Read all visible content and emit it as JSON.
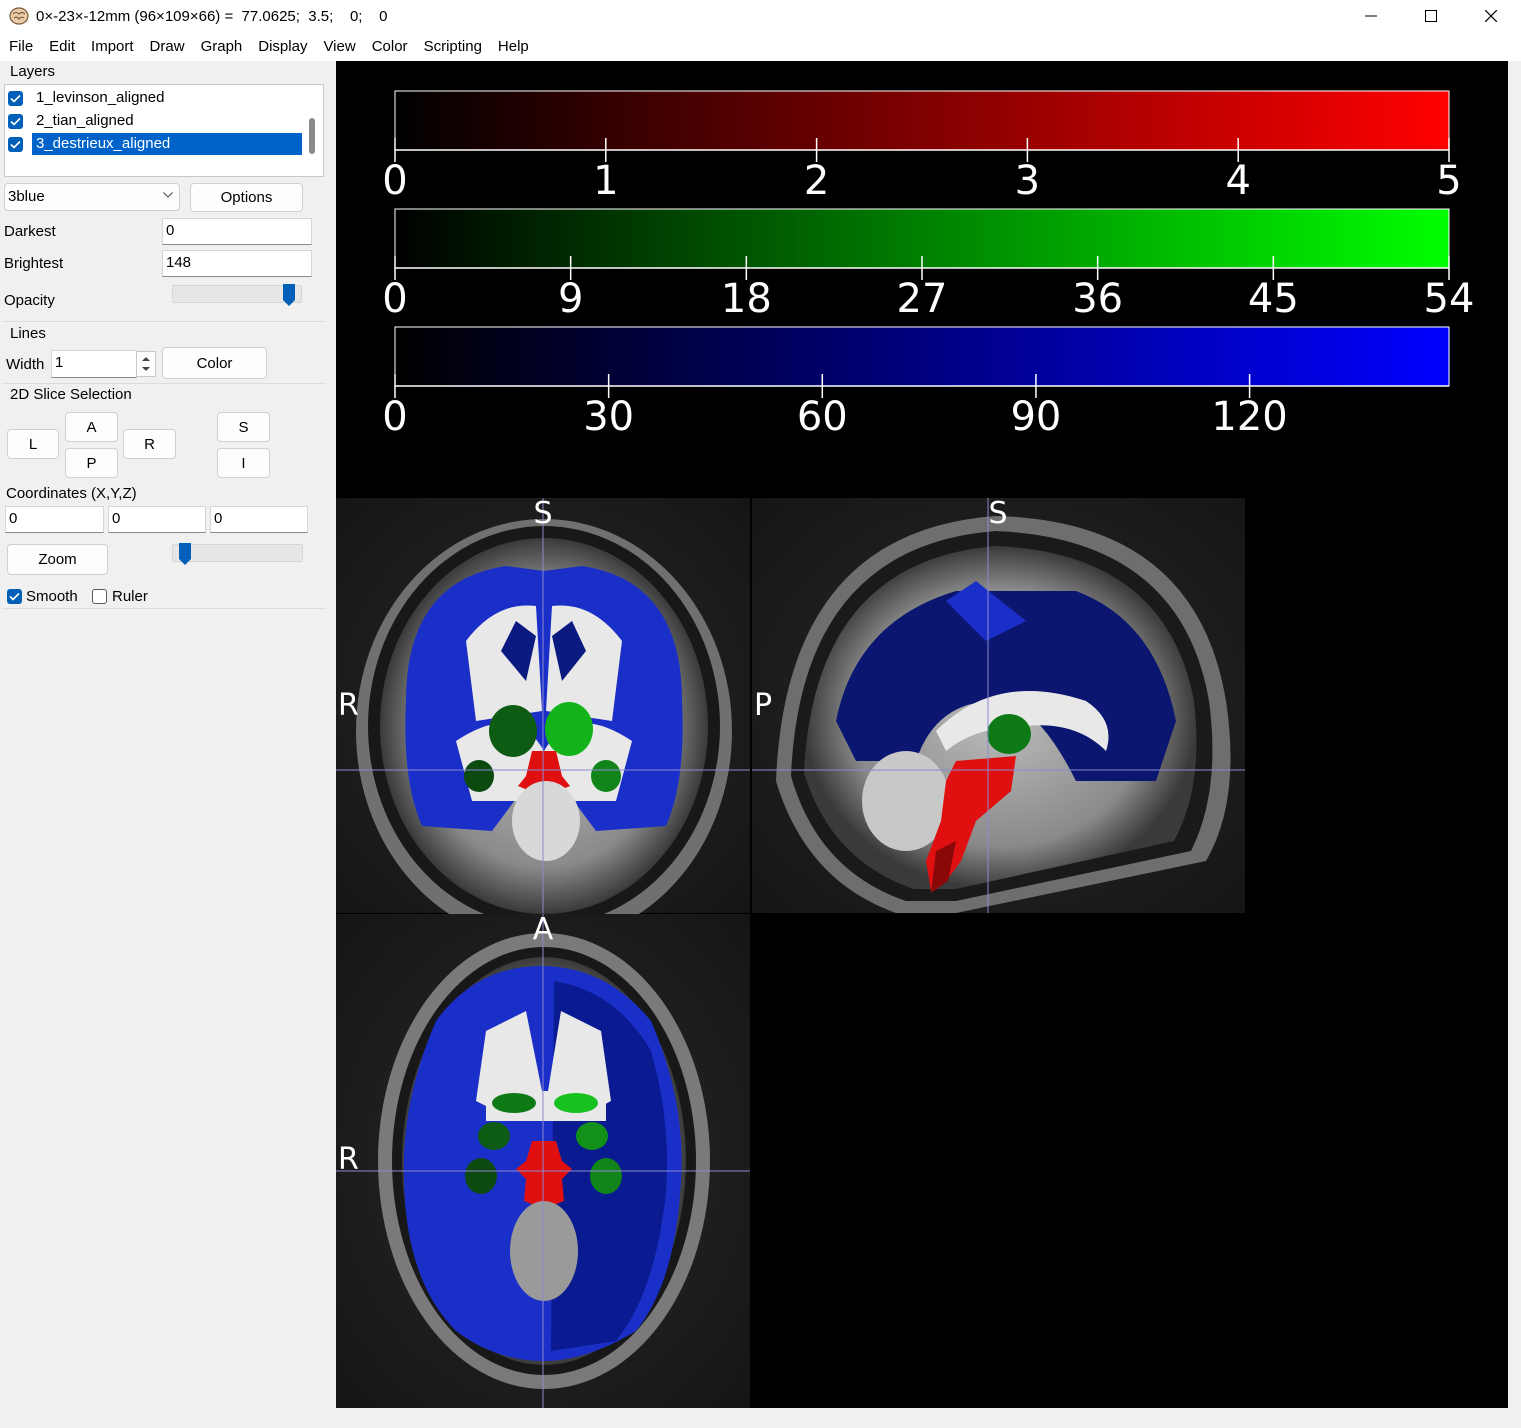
{
  "window": {
    "title": "0×-23×-12mm (96×109×66) =  77.0625;  3.5;    0;    0"
  },
  "menu": [
    "File",
    "Edit",
    "Import",
    "Draw",
    "Graph",
    "Display",
    "View",
    "Color",
    "Scripting",
    "Help"
  ],
  "layers": {
    "title": "Layers",
    "items": [
      {
        "label": "1_levinson_aligned",
        "checked": true,
        "selected": false
      },
      {
        "label": "2_tian_aligned",
        "checked": true,
        "selected": false
      },
      {
        "label": "3_destrieux_aligned",
        "checked": true,
        "selected": true
      }
    ],
    "colormap": "3blue",
    "options_label": "Options",
    "darkest_label": "Darkest",
    "darkest_value": "0",
    "brightest_label": "Brightest",
    "brightest_value": "148",
    "opacity_label": "Opacity",
    "opacity_level": 0.95
  },
  "lines": {
    "title": "Lines",
    "width_label": "Width",
    "width_value": "1",
    "color_label": "Color"
  },
  "slice_selection": {
    "title": "2D Slice Selection",
    "buttons": {
      "L": "L",
      "A": "A",
      "P": "P",
      "R": "R",
      "S": "S",
      "I": "I"
    },
    "coords_label": "Coordinates (X,Y,Z)",
    "x": "0",
    "y": "0",
    "z": "0",
    "zoom_label": "Zoom",
    "zoom_level": 0.05,
    "smooth_label": "Smooth",
    "smooth_checked": true,
    "ruler_label": "Ruler",
    "ruler_checked": false
  },
  "colorbars": [
    {
      "ticks": [
        "0",
        "1",
        "2",
        "3",
        "4",
        "5"
      ],
      "min": 0,
      "max": 5,
      "color": "#ff0000"
    },
    {
      "ticks": [
        "0",
        "9",
        "18",
        "27",
        "36",
        "45",
        "54"
      ],
      "min": 0,
      "max": 54,
      "color": "#00ff00"
    },
    {
      "ticks": [
        "0",
        "30",
        "60",
        "90",
        "120"
      ],
      "min": 0,
      "max": 148,
      "color": "#0000ff"
    }
  ],
  "orientation_labels": {
    "coronal_top": "S",
    "coronal_left": "R",
    "sagittal_top": "S",
    "sagittal_left": "P",
    "axial_top": "A",
    "axial_left": "R"
  }
}
